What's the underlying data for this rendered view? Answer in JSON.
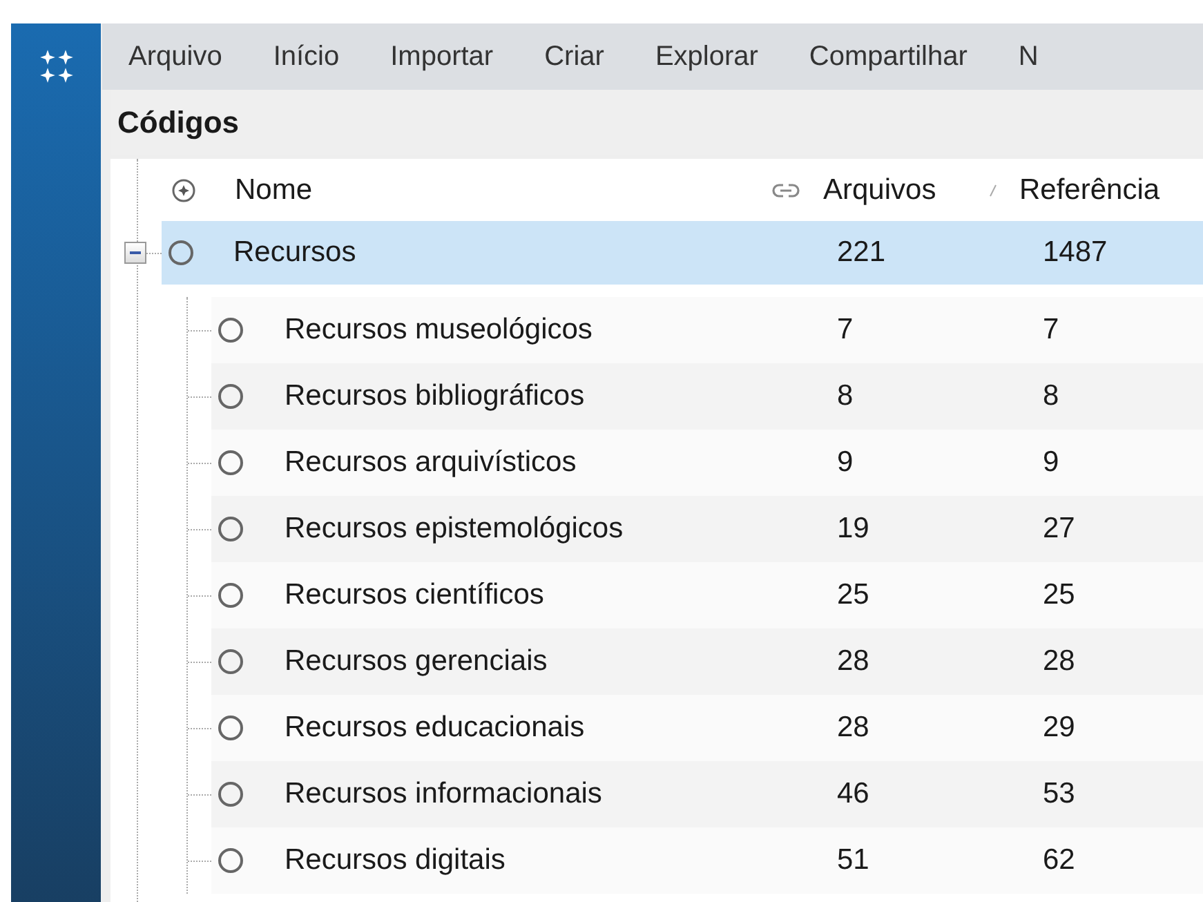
{
  "menu": [
    {
      "label": "Arquivo"
    },
    {
      "label": "Início"
    },
    {
      "label": "Importar"
    },
    {
      "label": "Criar"
    },
    {
      "label": "Explorar"
    },
    {
      "label": "Compartilhar"
    },
    {
      "label": "N"
    }
  ],
  "panel_title": "Códigos",
  "columns": {
    "name": "Nome",
    "files": "Arquivos",
    "references": "Referência"
  },
  "tree": [
    {
      "name": "Recursos",
      "files": "221",
      "references": "1487",
      "selected": true,
      "expanded": true,
      "children": [
        {
          "name": "Recursos museológicos",
          "files": "7",
          "references": "7",
          "selected": false
        },
        {
          "name": "Recursos bibliográficos",
          "files": "8",
          "references": "8",
          "selected": false
        },
        {
          "name": "Recursos arquivísticos",
          "files": "9",
          "references": "9",
          "selected": false
        },
        {
          "name": "Recursos epistemológicos",
          "files": "19",
          "references": "27",
          "selected": false
        },
        {
          "name": "Recursos científicos",
          "files": "25",
          "references": "25",
          "selected": false
        },
        {
          "name": "Recursos gerenciais",
          "files": "28",
          "references": "28",
          "selected": false
        },
        {
          "name": "Recursos educacionais",
          "files": "28",
          "references": "29",
          "selected": false
        },
        {
          "name": "Recursos informacionais",
          "files": "46",
          "references": "53",
          "selected": false
        },
        {
          "name": "Recursos digitais",
          "files": "51",
          "references": "62",
          "selected": false
        }
      ]
    }
  ]
}
